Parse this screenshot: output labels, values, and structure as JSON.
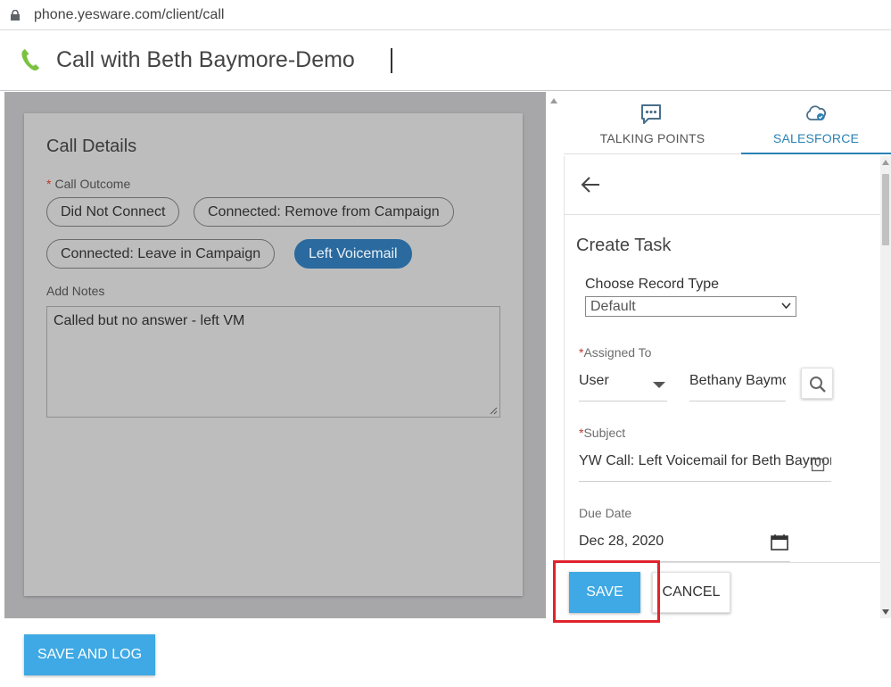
{
  "browser": {
    "url": "phone.yesware.com/client/call"
  },
  "header": {
    "title": "Call with Beth Baymore-Demo"
  },
  "call_details": {
    "title": "Call Details",
    "outcome_label": "Call Outcome",
    "outcome_required_mark": "*",
    "outcomes": [
      {
        "label": "Did Not Connect",
        "selected": false
      },
      {
        "label": "Connected: Remove from Campaign",
        "selected": false
      },
      {
        "label": "Connected: Leave in Campaign",
        "selected": false
      },
      {
        "label": "Left Voicemail",
        "selected": true
      }
    ],
    "notes_label": "Add Notes",
    "notes_value": "Called but no answer - left VM"
  },
  "tabs": [
    {
      "label": "TALKING POINTS",
      "icon": "chat-icon",
      "active": false
    },
    {
      "label": "SALESFORCE",
      "icon": "salesforce-cloud-icon",
      "active": true
    }
  ],
  "task_form": {
    "title": "Create Task",
    "record_type_label": "Choose Record Type",
    "record_type_value": "Default",
    "assigned_to_label": "Assigned To",
    "assigned_to_required_mark": "*",
    "assignee_type": "User",
    "assignee_name": "Bethany Baymore",
    "subject_label": "Subject",
    "subject_required_mark": "*",
    "subject_value": "YW Call: Left Voicemail for Beth Baymore",
    "due_date_label": "Due Date",
    "due_date_value": "Dec 28, 2020"
  },
  "actions": {
    "save_label": "SAVE",
    "cancel_label": "CANCEL"
  },
  "footer": {
    "save_and_log_label": "SAVE AND LOG"
  },
  "colors": {
    "accent": "#3ea9e4",
    "selected_pill": "#2a6a9e",
    "tab_active": "#2a82b5",
    "phone_green": "#7cc242",
    "highlight": "#e0232b"
  }
}
